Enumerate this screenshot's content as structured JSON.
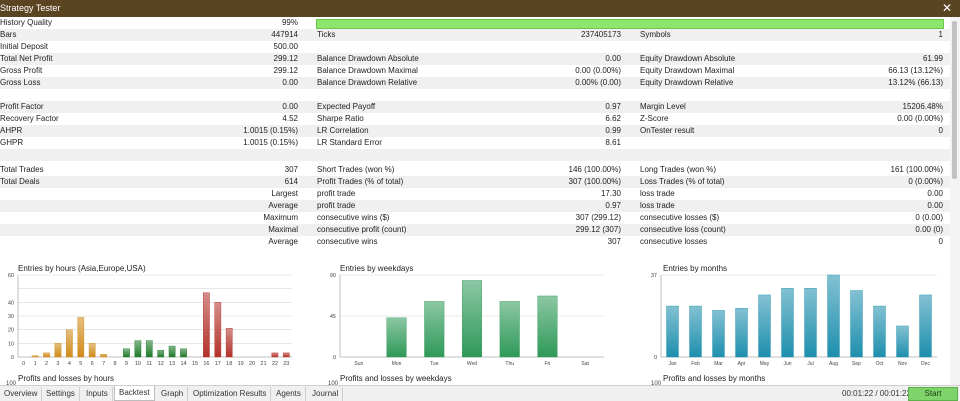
{
  "window": {
    "title": "Strategy Tester",
    "close_icon": "✕"
  },
  "stats": {
    "row0": {
      "l1": "History Quality",
      "v1": "99%"
    },
    "row1": {
      "l1": "Bars",
      "v1": "447914",
      "l2": "Ticks",
      "v2": "237405173",
      "l3": "Symbols",
      "v3": "1"
    },
    "row2": {
      "l1": "Initial Deposit",
      "v1": "500.00"
    },
    "row3": {
      "l1": "Total Net Profit",
      "v1": "299.12",
      "l2": "Balance Drawdown Absolute",
      "v2": "0.00",
      "l3": "Equity Drawdown Absolute",
      "v3": "61.99"
    },
    "row4": {
      "l1": "Gross Profit",
      "v1": "299.12",
      "l2": "Balance Drawdown Maximal",
      "v2": "0.00 (0.00%)",
      "l3": "Equity Drawdown Maximal",
      "v3": "66.13 (13.12%)"
    },
    "row5": {
      "l1": "Gross Loss",
      "v1": "0.00",
      "l2": "Balance Drawdown Relative",
      "v2": "0.00% (0.00)",
      "l3": "Equity Drawdown Relative",
      "v3": "13.12% (66.13)"
    },
    "row7": {
      "l1": "Profit Factor",
      "v1": "0.00",
      "l2": "Expected Payoff",
      "v2": "0.97",
      "l3": "Margin Level",
      "v3": "15206.48%"
    },
    "row8": {
      "l1": "Recovery Factor",
      "v1": "4.52",
      "l2": "Sharpe Ratio",
      "v2": "6.62",
      "l3": "Z-Score",
      "v3": "0.00 (0.00%)"
    },
    "row9": {
      "l1": "AHPR",
      "v1": "1.0015 (0.15%)",
      "l2": "LR Correlation",
      "v2": "0.99",
      "l3": "OnTester result",
      "v3": "0"
    },
    "row10": {
      "l1": "GHPR",
      "v1": "1.0015 (0.15%)",
      "l2": "LR Standard Error",
      "v2": "8.61"
    },
    "row12": {
      "l1": "Total Trades",
      "v1": "307",
      "l2": "Short Trades (won %)",
      "v2": "146 (100.00%)",
      "l3": "Long Trades (won %)",
      "v3": "161 (100.00%)"
    },
    "row13": {
      "l1": "Total Deals",
      "v1": "614",
      "l2": "Profit Trades (% of total)",
      "v2": "307 (100.00%)",
      "l3": "Loss Trades (% of total)",
      "v3": "0 (0.00%)"
    },
    "row14": {
      "l1": "Largest",
      "l2": "profit trade",
      "v2": "17.30",
      "l3": "loss trade",
      "v3": "0.00"
    },
    "row15": {
      "l1": "Average",
      "l2": "profit trade",
      "v2": "0.97",
      "l3": "loss trade",
      "v3": "0.00"
    },
    "row16": {
      "l1": "Maximum",
      "l2": "consecutive wins ($)",
      "v2": "307 (299.12)",
      "l3": "consecutive losses ($)",
      "v3": "0 (0.00)"
    },
    "row17": {
      "l1": "Maximal",
      "l2": "consecutive profit (count)",
      "v2": "299.12 (307)",
      "l3": "consecutive loss (count)",
      "v3": "0.00 (0)"
    },
    "row18": {
      "l1": "Average",
      "l2": "consecutive wins",
      "v2": "307",
      "l3": "consecutive losses",
      "v3": "0"
    }
  },
  "chart_data": [
    {
      "type": "bar",
      "title": "Entries by hours (Asia,Europe,USA)",
      "subtitle": "Profits and losses by hours",
      "subtitle_tick": "100",
      "categories": [
        "0",
        "1",
        "2",
        "3",
        "4",
        "5",
        "6",
        "7",
        "8",
        "9",
        "10",
        "11",
        "12",
        "13",
        "14",
        "15",
        "16",
        "17",
        "18",
        "19",
        "20",
        "21",
        "22",
        "23"
      ],
      "values": [
        0,
        1,
        3,
        10,
        20,
        29,
        10,
        2,
        0,
        6,
        12,
        12,
        5,
        8,
        6,
        0,
        47,
        40,
        21,
        0,
        0,
        0,
        3,
        3
      ],
      "ylim": [
        0,
        60
      ],
      "yticks": [
        "0",
        "10",
        "20",
        "30",
        "40",
        "60"
      ],
      "colors": {
        "asia": "#d08a18",
        "europe": "#1f7a2a",
        "usa": "#b3322a"
      }
    },
    {
      "type": "bar",
      "title": "Entries by weekdays",
      "subtitle": "Profits and losses by weekdays",
      "subtitle_tick": "100",
      "categories": [
        "Sun",
        "Mon",
        "Tue",
        "Wed",
        "Thu",
        "Fri",
        "Sat"
      ],
      "values": [
        0,
        43,
        61,
        84,
        61,
        67,
        0
      ],
      "ylim": [
        0,
        90
      ],
      "yticks": [
        "0",
        "45",
        "90"
      ],
      "colors": {
        "bar": "#2e9958"
      }
    },
    {
      "type": "bar",
      "title": "Entries by months",
      "subtitle": "Profits and losses by months",
      "subtitle_tick": "100",
      "categories": [
        "Jan",
        "Feb",
        "Mar",
        "Apr",
        "May",
        "Jun",
        "Jul",
        "Aug",
        "Sep",
        "Oct",
        "Nov",
        "Dec"
      ],
      "values": [
        23,
        23,
        21,
        22,
        28,
        31,
        31,
        37,
        30,
        23,
        14,
        28
      ],
      "ylim": [
        0,
        37
      ],
      "yticks": [
        "0",
        "37"
      ],
      "colors": {
        "bar": "#1e8fae"
      }
    }
  ],
  "tabs": [
    {
      "label": "Overview"
    },
    {
      "label": "Settings"
    },
    {
      "label": "Inputs"
    },
    {
      "label": "Backtest"
    },
    {
      "label": "Graph"
    },
    {
      "label": "Optimization Results"
    },
    {
      "label": "Agents"
    },
    {
      "label": "Journal"
    }
  ],
  "status": {
    "timer": "00:01:22 / 00:01:22",
    "start_label": "Start"
  }
}
